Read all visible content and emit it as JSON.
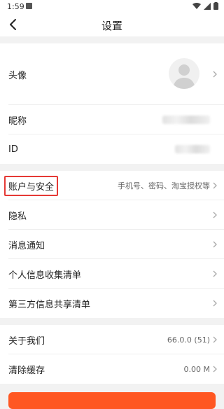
{
  "status_bar": {
    "time": "1:59"
  },
  "header": {
    "title": "设置"
  },
  "sections": [
    {
      "rows": [
        {
          "label": "头像"
        },
        {
          "label": "昵称"
        },
        {
          "label": "ID"
        }
      ]
    },
    {
      "rows": [
        {
          "label": "账户与安全",
          "value": "手机号、密码、淘宝授权等",
          "highlighted": true
        },
        {
          "label": "隐私"
        },
        {
          "label": "消息通知"
        },
        {
          "label": "个人信息收集清单"
        },
        {
          "label": "第三方信息共享清单"
        }
      ]
    },
    {
      "rows": [
        {
          "label": "关于我们",
          "value": "66.0.0 (51)"
        },
        {
          "label": "清除缓存",
          "value": "0.00 M"
        }
      ]
    }
  ],
  "colors": {
    "accent": "#ff5722",
    "highlight_border": "#e53935"
  }
}
